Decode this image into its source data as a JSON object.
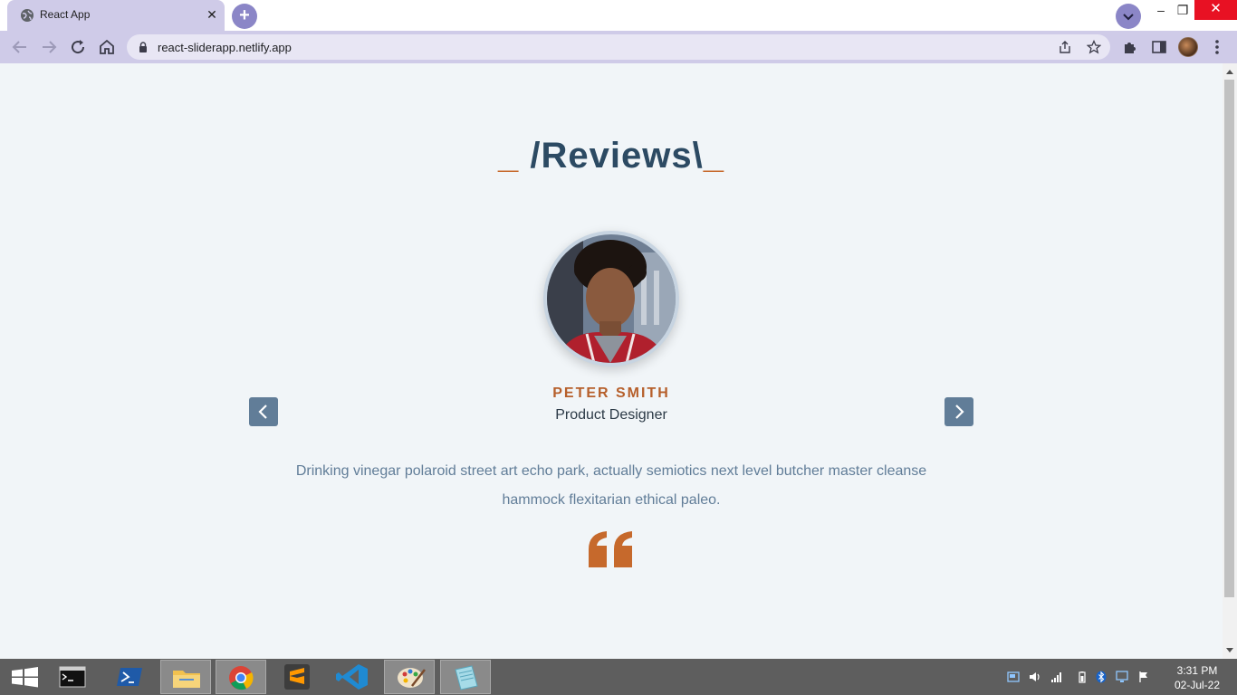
{
  "browser": {
    "tab_title": "React App",
    "tab_close": "✕",
    "new_tab": "+",
    "url": "react-sliderapp.netlify.app",
    "window_controls": {
      "minimize": "–",
      "maximize": "❐",
      "close": "✕"
    }
  },
  "page": {
    "title_left_underscore": "_",
    "title_text": " /Reviews\\",
    "title_right_underscore": "_",
    "reviewer": {
      "name": "PETER SMITH",
      "job": "Product Designer",
      "text": "Drinking vinegar polaroid street art echo park, actually semiotics next level butcher master cleanse hammock flexitarian ethical paleo."
    },
    "prev_icon": "chevron-left-icon",
    "next_icon": "chevron-right-icon",
    "quote_icon": "quote-icon"
  },
  "taskbar": {
    "time": "3:31 PM",
    "date": "02-Jul-22",
    "apps": [
      "windows-start",
      "command-prompt",
      "powershell",
      "file-explorer",
      "chrome",
      "sublime-text",
      "vscode",
      "paint",
      "notepad"
    ]
  },
  "colors": {
    "title": "#2c4a63",
    "accent": "#c6692c",
    "name": "#b65f2b",
    "button": "#617d98",
    "text": "#617d98",
    "page_bg": "#f1f5f8",
    "chrome": "#cfcbe8"
  }
}
